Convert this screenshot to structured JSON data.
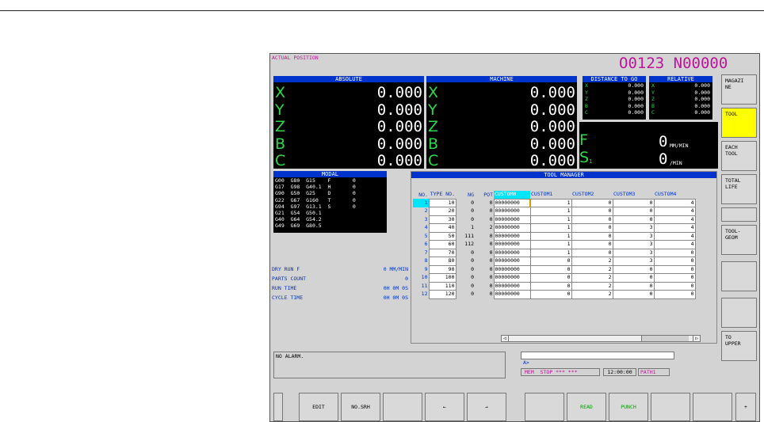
{
  "header": {
    "mode": "ACTUAL POSITION",
    "program": "O0123 N00000"
  },
  "absolute": {
    "title": "ABSOLUTE",
    "rows": [
      {
        "axis": "X",
        "value": "0.000"
      },
      {
        "axis": "Y",
        "value": "0.000"
      },
      {
        "axis": "Z",
        "value": "0.000"
      },
      {
        "axis": "B",
        "value": "0.000"
      },
      {
        "axis": "C",
        "value": "0.000"
      }
    ]
  },
  "machine": {
    "title": "MACHINE",
    "rows": [
      {
        "axis": "X",
        "value": "0.000"
      },
      {
        "axis": "Y",
        "value": "0.000"
      },
      {
        "axis": "Z",
        "value": "0.000"
      },
      {
        "axis": "B",
        "value": "0.000"
      },
      {
        "axis": "C",
        "value": "0.000"
      }
    ]
  },
  "distance_to_go": {
    "title": "DISTANCE TO GO",
    "rows": [
      {
        "axis": "X",
        "value": "0.000"
      },
      {
        "axis": "Y",
        "value": "0.000"
      },
      {
        "axis": "Z",
        "value": "0.000"
      },
      {
        "axis": "B",
        "value": "0.000"
      },
      {
        "axis": "C",
        "value": "0.000"
      }
    ]
  },
  "relative": {
    "title": "RELATIVE",
    "rows": [
      {
        "axis": "X",
        "value": "0.000"
      },
      {
        "axis": "Y",
        "value": "0.000"
      },
      {
        "axis": "Z",
        "value": "0.000"
      },
      {
        "axis": "B",
        "value": "0.000"
      },
      {
        "axis": "C",
        "value": "0.000"
      }
    ]
  },
  "feed": {
    "f_label": "F",
    "s_label": "S",
    "s_sub": "1",
    "f_value": "0",
    "f_unit": "MM/MIN",
    "s_value": "0",
    "s_unit": "/MIN"
  },
  "modal": {
    "title": "MODAL",
    "lines": [
      "G00  G80  G15    F       0",
      "G17  G98  G40.1  H       0",
      "G90  G50  G25    D       0",
      "G22  G67  G160   T       0",
      "G94  G97  G13.1  S       0",
      "G21  G54  G50.1",
      "G40  G64  G54.2",
      "G49  G69  G80.5"
    ]
  },
  "status_info": [
    {
      "label": "DRY RUN F",
      "value": "0 MM/MIN"
    },
    {
      "label": "PARTS COUNT",
      "value": "0"
    },
    {
      "label": "RUN TIME",
      "value": "0H 0M 0S"
    },
    {
      "label": "CYCLE TIME",
      "value": "0H 0M 0S"
    }
  ],
  "tool_manager": {
    "title": "TOOL MANAGER",
    "columns": [
      "NO.",
      "TYPE NO.",
      "NG",
      "POT",
      "CUSTOM0",
      "CUSTOM1",
      "CUSTOM2",
      "CUSTOM3",
      "CUSTOM4"
    ],
    "rows": [
      [
        "1",
        "10",
        "0",
        "0",
        "00000000",
        "1",
        "0",
        "0",
        "4"
      ],
      [
        "2",
        "20",
        "0",
        "0",
        "00000000",
        "1",
        "0",
        "0",
        "4"
      ],
      [
        "3",
        "30",
        "0",
        "0",
        "00000000",
        "1",
        "0",
        "0",
        "4"
      ],
      [
        "4",
        "40",
        "1",
        "2",
        "00000000",
        "1",
        "0",
        "3",
        "4"
      ],
      [
        "5",
        "50",
        "111",
        "0",
        "00000000",
        "1",
        "0",
        "3",
        "4"
      ],
      [
        "6",
        "60",
        "112",
        "0",
        "00000000",
        "1",
        "0",
        "3",
        "4"
      ],
      [
        "7",
        "70",
        "0",
        "0",
        "00000000",
        "1",
        "0",
        "3",
        "0"
      ],
      [
        "8",
        "80",
        "0",
        "0",
        "00000000",
        "0",
        "2",
        "3",
        "0"
      ],
      [
        "9",
        "90",
        "0",
        "0",
        "00000000",
        "0",
        "2",
        "0",
        "0"
      ],
      [
        "10",
        "100",
        "0",
        "0",
        "00000000",
        "0",
        "2",
        "0",
        "0"
      ],
      [
        "11",
        "110",
        "0",
        "0",
        "00000000",
        "0",
        "2",
        "0",
        "0"
      ],
      [
        "12",
        "120",
        "0",
        "0",
        "00000000",
        "0",
        "2",
        "0",
        "0"
      ]
    ]
  },
  "alarm": {
    "text": "NO ALARM."
  },
  "input": {
    "prompt": "A>"
  },
  "status_bar": {
    "mode": "MEM",
    "state": "STOP *** ***",
    "time": "12:00:00",
    "path": "PATH1"
  },
  "right_softkeys": [
    "MAGAZI\nNE",
    "TOOL",
    "EACH\nTOOL",
    "TOTAL\nLIFE",
    "",
    "TOOL-\nGEOM",
    "",
    "",
    "TO\nUPPER"
  ],
  "bottom_softkeys": [
    "",
    "EDIT",
    "NO.SRH",
    "",
    "←",
    "→",
    "",
    "READ",
    "PUNCH",
    "",
    "",
    "+"
  ],
  "colors": {
    "screen_bg": "#d3d3d3",
    "header_blue": "#0033cc",
    "axis_green": "#2bd94a",
    "program_magenta": "#c0149a",
    "selected_key": "#ffff00",
    "selected_cell": "#00e5ff"
  }
}
